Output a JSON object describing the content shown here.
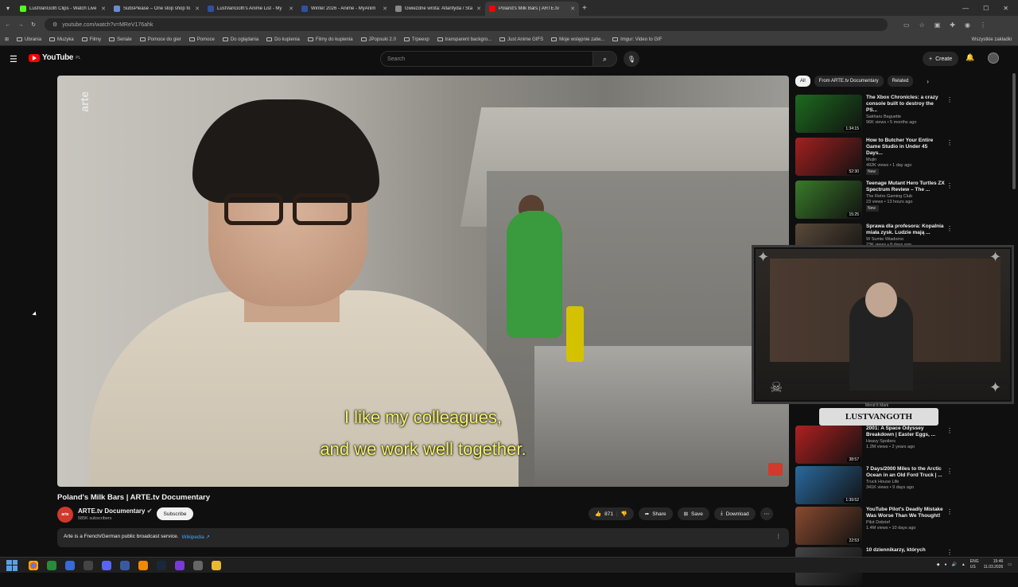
{
  "browser": {
    "tabs": [
      {
        "label": "LustVanGoth Clips - Watch Live",
        "color": "#53fc18"
      },
      {
        "label": "SubsPlease – One stop shop fo",
        "color": "#6a8bd0"
      },
      {
        "label": "LustVanGoth's Anime List - My",
        "color": "#2e51a2"
      },
      {
        "label": "Winter 2026 - Anime - MyAnim",
        "color": "#2e51a2"
      },
      {
        "label": "Gwiezdne wrota: Atlantyda / Sta",
        "color": "#888888"
      },
      {
        "label": "Poland's Milk Bars | ARTE.tv",
        "color": "#ff0000"
      }
    ],
    "url": "youtube.com/watch?v=MReV176ahk",
    "bookmarks": [
      "Ubrania",
      "Muzyka",
      "Filmy",
      "Seriale",
      "Pomoce do gier",
      "Pomoce",
      "Do oglądania",
      "Do kupienia",
      "Filmy do kupienia",
      "JPopsuki 2.0",
      "Trpeexp",
      "transparent backgro...",
      "Just Anime GIFS",
      "Moje wstępnie zatw...",
      "Imgur: Video to GIF"
    ],
    "all_bookmarks": "Wszystkie zakładki"
  },
  "youtube": {
    "logo": "YouTube",
    "region": "PL",
    "search_placeholder": "Search",
    "create_label": "Create"
  },
  "video": {
    "subtitle_line1": "I like my colleagues,",
    "subtitle_line2": "and we work well together.",
    "watermark": "arte",
    "title": "Poland's Milk Bars | ARTE.tv Documentary",
    "channel": "ARTE.tv Documentary",
    "subscribers": "585K subscribers",
    "subscribe_label": "Subscribe",
    "likes": "871",
    "share_label": "Share",
    "save_label": "Save",
    "download_label": "Download",
    "description": "Arte is a French/German public broadcast service.",
    "wiki_label": "Wikipedia"
  },
  "chips": [
    "All",
    "From ARTE.tv Documentary",
    "Related"
  ],
  "recommendations_top": [
    {
      "title": "The Xbox Chronicles: a crazy console built to destroy the PS...",
      "channel": "Sakharu Baguette",
      "meta": "96K views • 5 months ago",
      "duration": "1:34:15",
      "color": "#1d6b1f",
      "new": ""
    },
    {
      "title": "How to Butcher Your Entire Game Studio in Under 45 Days...",
      "channel": "Mujin",
      "meta": "492K views • 1 day ago",
      "duration": "52:30",
      "color": "#a32020",
      "new": "New"
    },
    {
      "title": "Teenage Mutant Hero Turtles ZX Spectrum Review – The ...",
      "channel": "The Retro Gaming Club",
      "meta": "23 views • 13 hours ago",
      "duration": "15:25",
      "color": "#3a7a2a",
      "new": "New"
    },
    {
      "title": "Sprawa dla profesora: Kopalnia miała zysk. Ludzie mają ...",
      "channel": "W Sumie Wiadomo",
      "meta": "23K views • 8 days ago",
      "duration": "",
      "color": "#5a4a3a",
      "new": ""
    }
  ],
  "recommendations_bottom": [
    {
      "title": "2001: A Space Odyssey Breakdown | Easter Eggs, ...",
      "channel": "Heavy Spoilers",
      "meta": "1.2M views • 2 years ago",
      "duration": "38:57",
      "color": "#b02020",
      "new": ""
    },
    {
      "title": "7 Days/2000 Miles to the Arctic Ocean in an Old Ford Truck | ...",
      "channel": "Truck House Life",
      "meta": "341K views • 9 days ago",
      "duration": "1:39:52",
      "color": "#2a6aa0",
      "new": ""
    },
    {
      "title": "YouTube Pilot's Deadly Mistake Was Worse Than We Thought!",
      "channel": "Pilot Debrief",
      "meta": "1.4M views • 10 days ago",
      "duration": "22:53",
      "color": "#8a4a30",
      "new": ""
    },
    {
      "title": "10 dziennikarzy, których",
      "channel": "",
      "meta": "",
      "duration": "",
      "color": "#444444",
      "new": ""
    }
  ],
  "overlay": {
    "channel_tag": "Mend It Mark",
    "name": "LUSTVANGOTH"
  },
  "taskbar": {
    "lang": "ENG",
    "region": "US",
    "time": "15:46",
    "date": "11.03.2026"
  }
}
